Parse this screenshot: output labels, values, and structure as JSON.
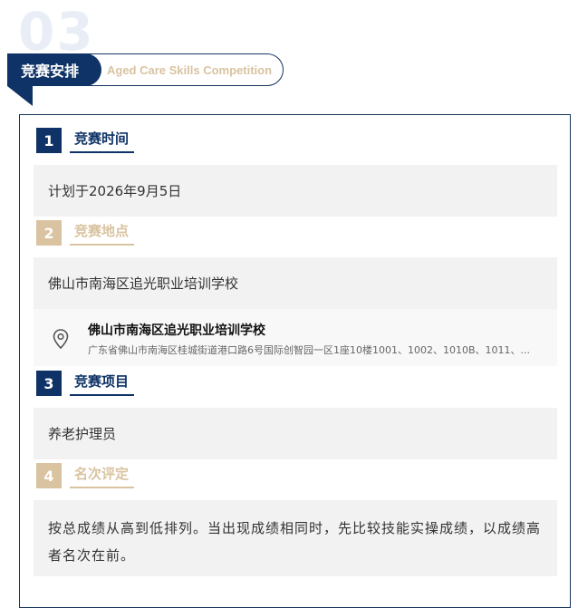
{
  "section_number": "03",
  "header": {
    "title": "竞赛安排",
    "subtitle": "Aged Care Skills Competition"
  },
  "sections": [
    {
      "number": "1",
      "title": "竞赛时间",
      "content": "计划于2026年9月5日"
    },
    {
      "number": "2",
      "title": "竞赛地点",
      "content": "佛山市南海区追光职业培训学校"
    },
    {
      "number": "3",
      "title": "竞赛项目",
      "content": "养老护理员"
    },
    {
      "number": "4",
      "title": "名次评定",
      "content": "按总成绩从高到低排列。当出现成绩相同时，先比较技能实操成绩，以成绩高者名次在前。"
    }
  ],
  "location_card": {
    "icon": "location-pin-icon",
    "name": "佛山市南海区追光职业培训学校",
    "address": "广东省佛山市南海区桂城街道港口路6号国际创智园一区1座10楼1001、1002、1010B、1011、..."
  },
  "colors": {
    "primary": "#0f3366",
    "accent": "#d9c3a0",
    "panel": "#f2f2f2"
  }
}
